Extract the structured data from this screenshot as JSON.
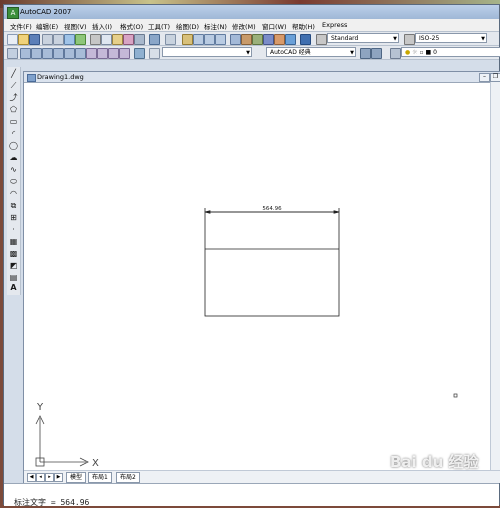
{
  "app": {
    "title": "AutoCAD 2007",
    "icon": "autocad-icon",
    "menu": [
      "文件(F)",
      "编辑(E)",
      "视图(V)",
      "插入(I)",
      "格式(O)",
      "工具(T)",
      "绘图(D)",
      "标注(N)",
      "修改(M)",
      "窗口(W)",
      "帮助(H)",
      "Express"
    ]
  },
  "toolbar": {
    "text_style": "Standard",
    "dim_style": "ISO-25",
    "workspace": "AutoCAD 经典",
    "layer": "0"
  },
  "document": {
    "title": "Drawing1.dwg",
    "dimension_text": "564.96"
  },
  "ucs": {
    "x_label": "X",
    "y_label": "Y"
  },
  "layout_tabs": [
    "模型",
    "布局1",
    "布局2"
  ],
  "command_line": {
    "text": "标注文字 = 564.96"
  },
  "watermark": "Bai du 经验",
  "colors": {
    "title_bar": "#9fb7d6",
    "canvas": "#ffffff",
    "geometry": "#222222"
  }
}
